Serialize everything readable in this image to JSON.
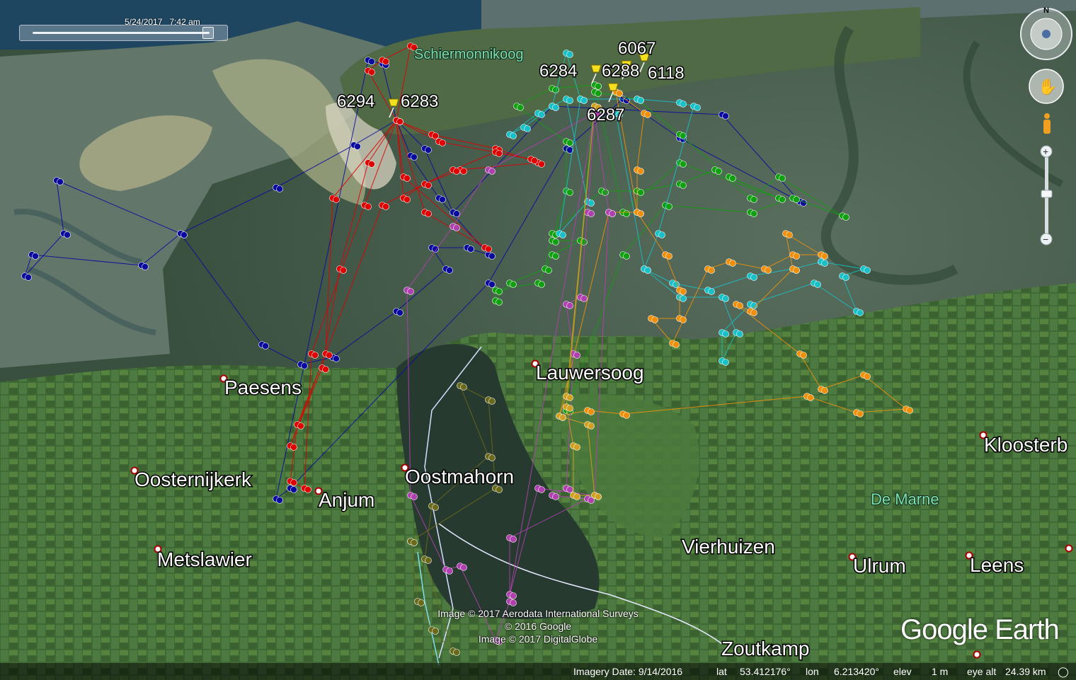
{
  "app": {
    "time_stamp": "5/24/2017   7:42 am",
    "logo": "Google Earth"
  },
  "places": [
    {
      "name": "Schiermonnikoog",
      "style": "green"
    },
    {
      "name": "Paesens",
      "style": "white"
    },
    {
      "name": "Oosternijkerk",
      "style": "white"
    },
    {
      "name": "Anjum",
      "style": "white"
    },
    {
      "name": "Oostmahorn",
      "style": "white"
    },
    {
      "name": "Lauwersoog",
      "style": "white"
    },
    {
      "name": "Metslawier",
      "style": "white"
    },
    {
      "name": "Vierhuizen",
      "style": "white"
    },
    {
      "name": "Ulrum",
      "style": "white"
    },
    {
      "name": "Leens",
      "style": "white"
    },
    {
      "name": "Kloosterb",
      "style": "white"
    },
    {
      "name": "De Marne",
      "style": "green"
    },
    {
      "name": "Zoutkamp",
      "style": "white"
    }
  ],
  "tags": [
    "6294",
    "6283",
    "6067",
    "6284",
    "6288",
    "6118",
    "6287"
  ],
  "tracks": [
    {
      "color": "#0a0a9e"
    },
    {
      "color": "#e00000"
    },
    {
      "color": "#10a010"
    },
    {
      "color": "#18c0c8"
    },
    {
      "color": "#f0900a"
    },
    {
      "color": "#b040b0"
    },
    {
      "color": "#6a6a1a"
    },
    {
      "color": "#d2a020"
    }
  ],
  "attribution": {
    "line1": "Image © 2017 Aerodata International Surveys",
    "line2": "© 2016 Google",
    "line3": "Image © 2017 DigitalGlobe"
  },
  "status": {
    "imagery_date": "Imagery Date: 9/14/2016",
    "lat_label": "lat",
    "lat_value": "53.412176°",
    "lon_label": "lon",
    "lon_value": "6.213420°",
    "elev_label": "elev",
    "elev_value": "1 m",
    "eye_label": "eye alt",
    "eye_value": "24.39 km"
  },
  "nav": {
    "north_label": "N",
    "zoom_in": "+",
    "zoom_out": "−"
  }
}
